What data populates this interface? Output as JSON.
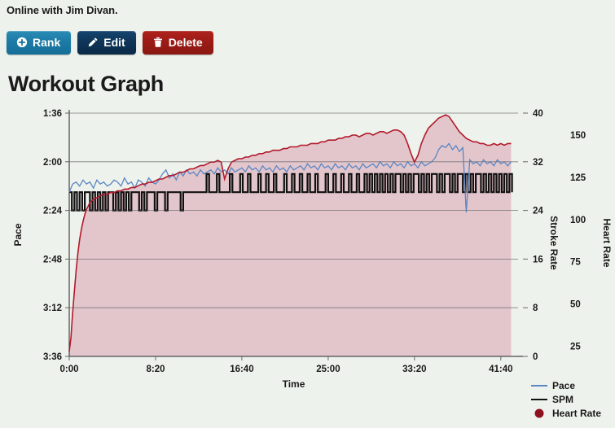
{
  "status": {
    "text": "Online with Jim Divan."
  },
  "toolbar": {
    "rank_label": "Rank",
    "edit_label": "Edit",
    "delete_label": "Delete",
    "rank_icon": "plus-circle-icon",
    "edit_icon": "pencil-icon",
    "delete_icon": "trash-icon",
    "rank_color": "#1b7ba6",
    "edit_color": "#0e3456",
    "delete_color": "#991b16"
  },
  "page": {
    "title": "Workout Graph"
  },
  "chart_data": {
    "type": "line",
    "title": "Workout Graph",
    "xlabel": "Time",
    "grid": true,
    "legend_position": "bottom-right",
    "background": "#eef2ec",
    "plot_background": "#eef2ec",
    "fill_color": "#e3c6cc",
    "x_ticks": [
      "0:00",
      "8:20",
      "16:40",
      "25:00",
      "33:20",
      "41:40"
    ],
    "x_tick_values": [
      0,
      500,
      1000,
      1500,
      2000,
      2500
    ],
    "xlim": [
      0,
      2600
    ],
    "axes": [
      {
        "name": "Pace",
        "label": "Pace",
        "side": "left",
        "color": "#5b86c4",
        "ticks": [
          "1:36",
          "2:00",
          "2:24",
          "2:48",
          "3:12",
          "3:36"
        ],
        "tick_values": [
          96,
          120,
          144,
          168,
          192,
          216
        ],
        "ylim": [
          96,
          216
        ],
        "inverted": true
      },
      {
        "name": "Stroke Rate",
        "label": "Stroke Rate",
        "side": "right",
        "color": "#111111",
        "ticks": [
          "40",
          "32",
          "24",
          "16",
          "8",
          "0"
        ],
        "tick_values": [
          40,
          32,
          24,
          16,
          8,
          0
        ],
        "ylim": [
          0,
          40
        ]
      },
      {
        "name": "Heart Rate",
        "label": "Heart Rate",
        "side": "right",
        "color": "#b21a2b",
        "ticks": [
          "150",
          "125",
          "100",
          "75",
          "50",
          "25"
        ],
        "tick_values": [
          150,
          125,
          100,
          75,
          50,
          25
        ],
        "ylim": [
          19,
          163
        ]
      }
    ],
    "legend": [
      {
        "label": "Pace",
        "color": "#5b86c4",
        "marker": "line"
      },
      {
        "label": "SPM",
        "color": "#111111",
        "marker": "line"
      },
      {
        "label": "Heart Rate",
        "color": "#8e1020",
        "marker": "circle"
      }
    ],
    "series": [
      {
        "name": "Pace",
        "axis": "Pace",
        "color": "#5b86c4",
        "units": "min/500m",
        "x": [
          0,
          20,
          40,
          60,
          80,
          100,
          120,
          140,
          160,
          180,
          200,
          220,
          240,
          260,
          280,
          300,
          320,
          340,
          360,
          380,
          400,
          420,
          440,
          460,
          480,
          500,
          520,
          540,
          560,
          580,
          600,
          620,
          640,
          660,
          680,
          700,
          720,
          740,
          760,
          780,
          800,
          820,
          840,
          860,
          880,
          900,
          920,
          940,
          960,
          980,
          1000,
          1020,
          1040,
          1060,
          1080,
          1100,
          1120,
          1140,
          1160,
          1180,
          1200,
          1220,
          1240,
          1260,
          1280,
          1300,
          1320,
          1340,
          1360,
          1380,
          1400,
          1420,
          1440,
          1460,
          1480,
          1500,
          1520,
          1540,
          1560,
          1580,
          1600,
          1620,
          1640,
          1660,
          1680,
          1700,
          1720,
          1740,
          1760,
          1780,
          1800,
          1820,
          1840,
          1860,
          1880,
          1900,
          1920,
          1940,
          1960,
          1980,
          2000,
          2020,
          2040,
          2060,
          2080,
          2100,
          2120,
          2140,
          2160,
          2180,
          2200,
          2220,
          2240,
          2260,
          2280,
          2300,
          2320,
          2340,
          2360,
          2380,
          2400,
          2420,
          2440,
          2460,
          2480,
          2500,
          2520,
          2540,
          2560
        ],
        "values": [
          135,
          131,
          130,
          132,
          129,
          131,
          130,
          133,
          129,
          131,
          130,
          132,
          131,
          129,
          130,
          132,
          128,
          131,
          130,
          133,
          129,
          130,
          132,
          128,
          130,
          131,
          129,
          126,
          124,
          128,
          126,
          129,
          125,
          127,
          124,
          126,
          125,
          127,
          124,
          126,
          125,
          124,
          126,
          123,
          125,
          124,
          126,
          123,
          125,
          124,
          123,
          125,
          122,
          124,
          123,
          125,
          122,
          124,
          123,
          125,
          122,
          124,
          123,
          125,
          122,
          124,
          123,
          122,
          124,
          121,
          123,
          122,
          124,
          121,
          123,
          122,
          124,
          121,
          123,
          122,
          124,
          121,
          123,
          122,
          124,
          121,
          123,
          122,
          121,
          123,
          120,
          122,
          121,
          123,
          120,
          122,
          121,
          123,
          120,
          122,
          121,
          123,
          120,
          122,
          121,
          120,
          118,
          114,
          112,
          113,
          111,
          114,
          112,
          115,
          113,
          145,
          119,
          121,
          120,
          122,
          119,
          121,
          120,
          122,
          119,
          121,
          120,
          122,
          120
        ]
      },
      {
        "name": "SPM",
        "axis": "Stroke Rate",
        "color": "#111111",
        "units": "strokes/min",
        "x": [
          0,
          15,
          30,
          45,
          60,
          75,
          90,
          105,
          120,
          135,
          150,
          165,
          180,
          195,
          210,
          225,
          240,
          255,
          270,
          285,
          300,
          315,
          330,
          345,
          360,
          375,
          390,
          405,
          420,
          435,
          450,
          465,
          480,
          495,
          510,
          525,
          540,
          555,
          570,
          585,
          600,
          615,
          630,
          645,
          660,
          675,
          690,
          705,
          720,
          735,
          750,
          765,
          780,
          795,
          810,
          825,
          840,
          855,
          870,
          885,
          900,
          915,
          930,
          945,
          960,
          975,
          990,
          1005,
          1020,
          1035,
          1050,
          1065,
          1080,
          1095,
          1110,
          1125,
          1140,
          1155,
          1170,
          1185,
          1200,
          1215,
          1230,
          1245,
          1260,
          1275,
          1290,
          1305,
          1320,
          1335,
          1350,
          1365,
          1380,
          1395,
          1410,
          1425,
          1440,
          1455,
          1470,
          1485,
          1500,
          1515,
          1530,
          1545,
          1560,
          1575,
          1590,
          1605,
          1620,
          1635,
          1650,
          1665,
          1680,
          1695,
          1710,
          1725,
          1740,
          1755,
          1770,
          1785,
          1800,
          1815,
          1830,
          1845,
          1860,
          1875,
          1890,
          1905,
          1920,
          1935,
          1950,
          1965,
          1980,
          1995,
          2010,
          2025,
          2040,
          2055,
          2070,
          2085,
          2100,
          2115,
          2130,
          2145,
          2160,
          2175,
          2190,
          2205,
          2220,
          2235,
          2250,
          2265,
          2280,
          2295,
          2310,
          2325,
          2340,
          2355,
          2370,
          2385,
          2400,
          2415,
          2430,
          2445,
          2460,
          2475,
          2490,
          2505,
          2520,
          2535,
          2550,
          2565
        ],
        "values": [
          27,
          24,
          27,
          24,
          27,
          24,
          27,
          27,
          24,
          27,
          24,
          27,
          24,
          27,
          24,
          27,
          27,
          24,
          27,
          24,
          27,
          24,
          27,
          24,
          27,
          27,
          27,
          24,
          27,
          24,
          27,
          27,
          27,
          24,
          27,
          27,
          27,
          24,
          27,
          27,
          27,
          27,
          27,
          24,
          27,
          27,
          27,
          27,
          27,
          27,
          27,
          27,
          27,
          30,
          27,
          27,
          27,
          30,
          27,
          27,
          27,
          27,
          30,
          27,
          27,
          27,
          30,
          27,
          27,
          30,
          27,
          27,
          27,
          30,
          27,
          27,
          30,
          27,
          27,
          30,
          27,
          27,
          27,
          30,
          27,
          27,
          30,
          27,
          27,
          30,
          27,
          27,
          30,
          27,
          27,
          30,
          27,
          27,
          27,
          30,
          27,
          27,
          30,
          27,
          27,
          30,
          27,
          27,
          30,
          27,
          27,
          30,
          27,
          27,
          30,
          27,
          30,
          27,
          30,
          27,
          30,
          27,
          30,
          27,
          30,
          27,
          30,
          30,
          27,
          30,
          27,
          30,
          27,
          30,
          30,
          27,
          30,
          27,
          30,
          27,
          30,
          30,
          27,
          30,
          27,
          30,
          30,
          27,
          30,
          27,
          30,
          30,
          27,
          30,
          27,
          30,
          27,
          30,
          30,
          27,
          30,
          27,
          30,
          27,
          30,
          27,
          30,
          27,
          30,
          27,
          30,
          27,
          30,
          27
        ]
      },
      {
        "name": "Heart Rate",
        "axis": "Heart Rate",
        "color": "#b21a2b",
        "units": "bpm",
        "x": [
          0,
          10,
          20,
          30,
          40,
          50,
          60,
          70,
          80,
          90,
          100,
          120,
          140,
          160,
          180,
          200,
          220,
          240,
          260,
          280,
          300,
          320,
          340,
          360,
          380,
          400,
          420,
          440,
          460,
          480,
          500,
          520,
          540,
          560,
          580,
          600,
          620,
          640,
          660,
          680,
          700,
          720,
          740,
          760,
          780,
          800,
          820,
          840,
          860,
          880,
          900,
          920,
          940,
          960,
          980,
          1000,
          1020,
          1040,
          1060,
          1080,
          1100,
          1120,
          1140,
          1160,
          1180,
          1200,
          1220,
          1240,
          1260,
          1280,
          1300,
          1320,
          1340,
          1360,
          1380,
          1400,
          1420,
          1440,
          1460,
          1480,
          1500,
          1520,
          1540,
          1560,
          1580,
          1600,
          1620,
          1640,
          1660,
          1680,
          1700,
          1720,
          1740,
          1760,
          1780,
          1800,
          1820,
          1840,
          1860,
          1880,
          1900,
          1920,
          1940,
          1960,
          1980,
          2000,
          2020,
          2040,
          2060,
          2080,
          2100,
          2120,
          2140,
          2160,
          2180,
          2200,
          2220,
          2240,
          2260,
          2280,
          2300,
          2320,
          2340,
          2360,
          2380,
          2400,
          2420,
          2440,
          2460,
          2480,
          2500,
          2520,
          2540,
          2560
        ],
        "values": [
          22,
          30,
          45,
          58,
          70,
          80,
          88,
          94,
          99,
          103,
          106,
          110,
          112,
          113,
          114,
          115,
          115,
          116,
          116,
          117,
          117,
          118,
          118,
          119,
          119,
          120,
          121,
          121,
          122,
          122,
          123,
          124,
          124,
          125,
          126,
          126,
          127,
          128,
          128,
          129,
          130,
          130,
          131,
          132,
          132,
          133,
          134,
          134,
          135,
          134,
          124,
          130,
          134,
          135,
          136,
          136,
          137,
          137,
          138,
          138,
          139,
          139,
          140,
          140,
          141,
          141,
          141,
          142,
          142,
          143,
          143,
          143,
          144,
          144,
          144,
          145,
          145,
          145,
          146,
          146,
          147,
          147,
          147,
          148,
          148,
          149,
          149,
          150,
          150,
          149,
          150,
          151,
          151,
          150,
          151,
          152,
          152,
          151,
          152,
          153,
          153,
          152,
          150,
          145,
          139,
          134,
          138,
          145,
          150,
          154,
          156,
          158,
          160,
          161,
          162,
          161,
          158,
          155,
          152,
          150,
          148,
          147,
          146,
          146,
          145,
          145,
          144,
          144,
          145,
          144,
          145,
          144,
          145,
          145
        ]
      }
    ]
  }
}
